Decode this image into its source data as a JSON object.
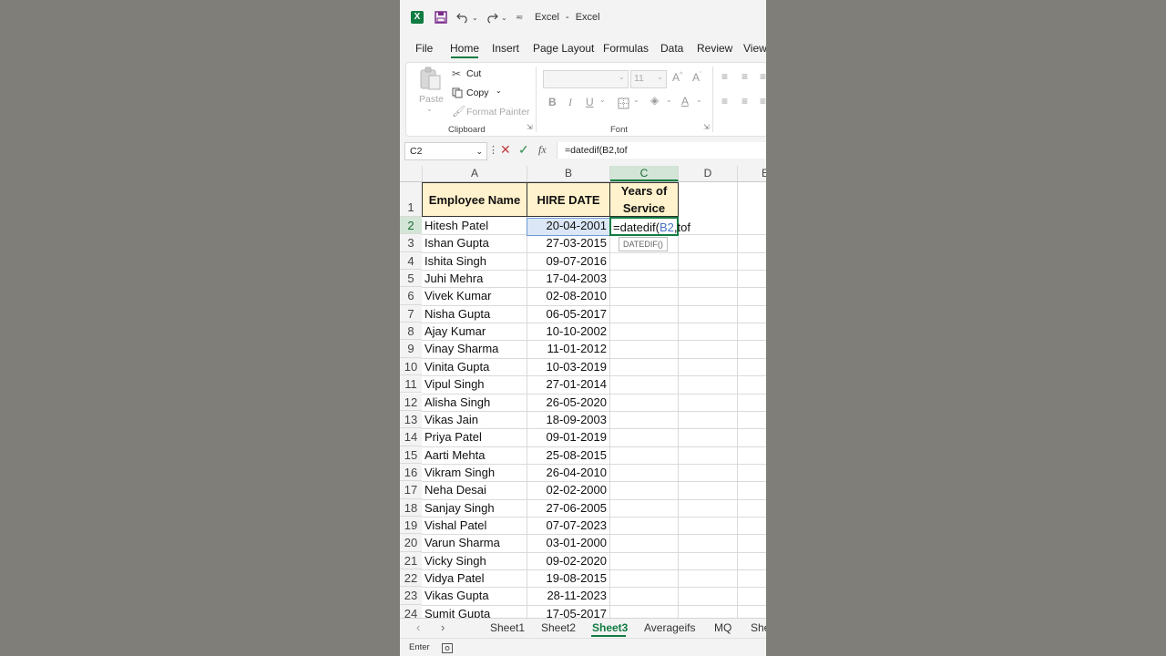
{
  "window": {
    "title": "Excel",
    "separator": "-",
    "app_name": "Excel"
  },
  "menu_tabs": [
    "File",
    "Home",
    "Insert",
    "Page Layout",
    "Formulas",
    "Data",
    "Review",
    "View"
  ],
  "ribbon": {
    "clipboard": {
      "paste_label": "Paste",
      "cut_label": "Cut",
      "copy_label": "Copy",
      "format_painter_label": "Format Painter",
      "group_label": "Clipboard"
    },
    "font": {
      "font_size": "11",
      "bold": "B",
      "italic": "I",
      "underline": "U",
      "group_label": "Font"
    }
  },
  "formula_bar": {
    "name_box": "C2",
    "formula": "=datedif(B2,tof",
    "fx_label": "fx"
  },
  "columns": [
    "A",
    "B",
    "C",
    "D",
    "E"
  ],
  "selected_column": "C",
  "headers": {
    "a": "Employee Name",
    "b": "HIRE DATE",
    "c_line1": "Years of",
    "c_line2": "Service"
  },
  "rows": [
    {
      "num": "2",
      "name": "Hitesh Patel",
      "date": "20-04-2001"
    },
    {
      "num": "3",
      "name": "Ishan Gupta",
      "date": "27-03-2015"
    },
    {
      "num": "4",
      "name": "Ishita Singh",
      "date": "09-07-2016"
    },
    {
      "num": "5",
      "name": "Juhi Mehra",
      "date": "17-04-2003"
    },
    {
      "num": "6",
      "name": "Vivek Kumar",
      "date": "02-08-2010"
    },
    {
      "num": "7",
      "name": "Nisha Gupta",
      "date": "06-05-2017"
    },
    {
      "num": "8",
      "name": "Ajay Kumar",
      "date": "10-10-2002"
    },
    {
      "num": "9",
      "name": "Vinay Sharma",
      "date": "11-01-2012"
    },
    {
      "num": "10",
      "name": "Vinita Gupta",
      "date": "10-03-2019"
    },
    {
      "num": "11",
      "name": "Vipul Singh",
      "date": "27-01-2014"
    },
    {
      "num": "12",
      "name": "Alisha Singh",
      "date": "26-05-2020"
    },
    {
      "num": "13",
      "name": "Vikas Jain",
      "date": "18-09-2003"
    },
    {
      "num": "14",
      "name": "Priya Patel",
      "date": "09-01-2019"
    },
    {
      "num": "15",
      "name": "Aarti Mehta",
      "date": "25-08-2015"
    },
    {
      "num": "16",
      "name": "Vikram Singh",
      "date": "26-04-2010"
    },
    {
      "num": "17",
      "name": "Neha Desai",
      "date": "02-02-2000"
    },
    {
      "num": "18",
      "name": "Sanjay Singh",
      "date": "27-06-2005"
    },
    {
      "num": "19",
      "name": "Vishal Patel",
      "date": "07-07-2023"
    },
    {
      "num": "20",
      "name": "Varun Sharma",
      "date": "03-01-2000"
    },
    {
      "num": "21",
      "name": "Vicky Singh",
      "date": "09-02-2020"
    },
    {
      "num": "22",
      "name": "Vidya Patel",
      "date": "19-08-2015"
    },
    {
      "num": "23",
      "name": "Vikas Gupta",
      "date": "28-11-2023"
    },
    {
      "num": "24",
      "name": "Sumit Gupta",
      "date": "17-05-2017"
    }
  ],
  "active_cell": {
    "prefix": "=datedif(",
    "ref": "B2",
    "suffix": ",tof",
    "tooltip": "DATEDIF()"
  },
  "sheet_tabs": [
    "Sheet1",
    "Sheet2",
    "Sheet3",
    "Averageifs",
    "MQ",
    "She"
  ],
  "active_sheet": "Sheet3",
  "status": {
    "mode": "Enter"
  },
  "colors": {
    "excel_green": "#107c41",
    "header_fill": "#fff2cc",
    "ref_blue": "#4472c4"
  }
}
